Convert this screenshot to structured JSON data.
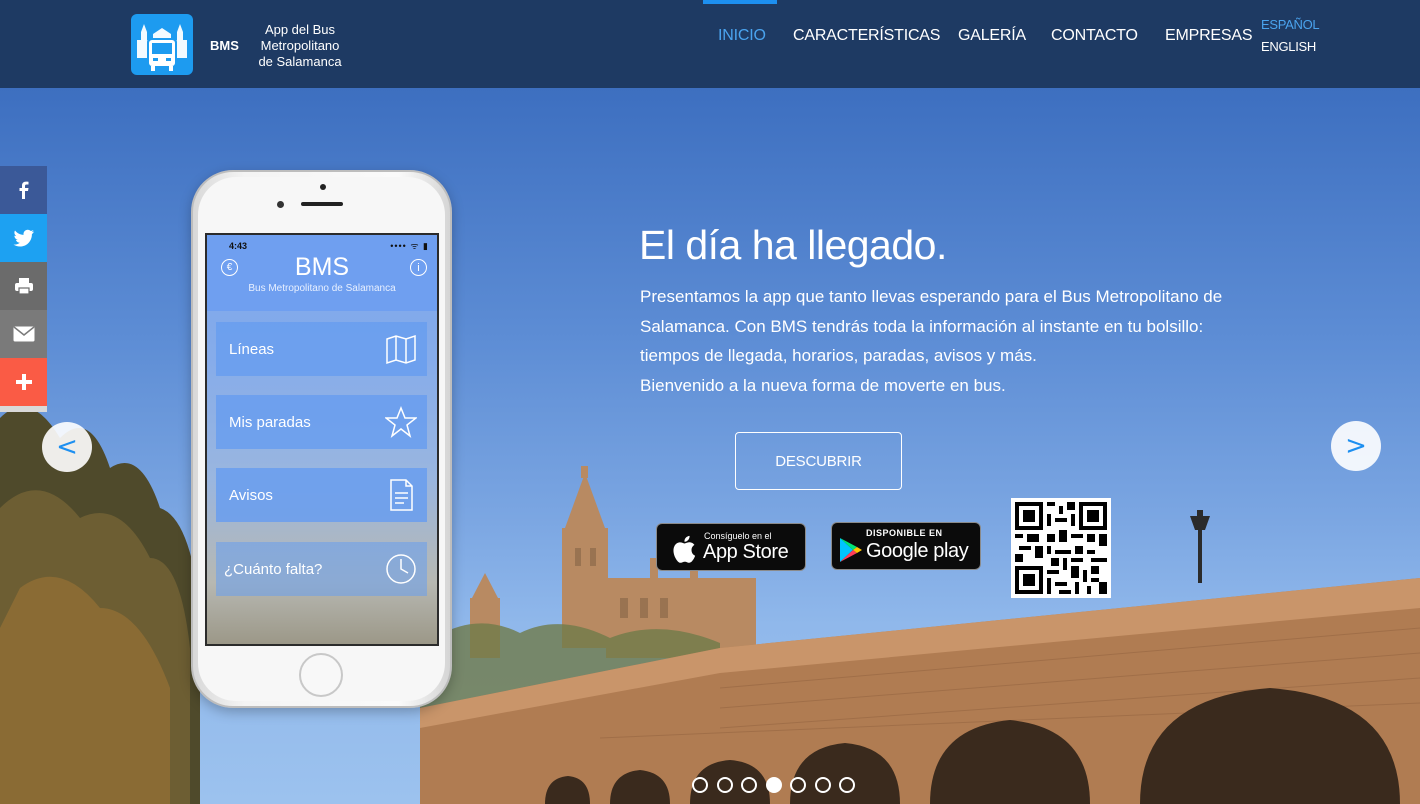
{
  "brand": {
    "short": "BMS",
    "tagline": [
      "App del Bus",
      "Metropolitano",
      "de Salamanca"
    ],
    "logo_icon": "bus-icon",
    "accent": "#1d8ff0"
  },
  "nav": {
    "items": [
      {
        "label": "INICIO",
        "active": true
      },
      {
        "label": "CARACTERÍSTICAS",
        "active": false
      },
      {
        "label": "GALERÍA",
        "active": false
      },
      {
        "label": "CONTACTO",
        "active": false
      },
      {
        "label": "EMPRESAS",
        "active": false
      }
    ],
    "languages": [
      {
        "label": "ESPAÑOL",
        "active": true
      },
      {
        "label": "ENGLISH",
        "active": false
      }
    ]
  },
  "social": [
    {
      "name": "facebook",
      "icon": "facebook-icon",
      "color": "#3b5998"
    },
    {
      "name": "twitter",
      "icon": "twitter-icon",
      "color": "#1da1f2"
    },
    {
      "name": "print",
      "icon": "printer-icon",
      "color": "#6b6b6b"
    },
    {
      "name": "email",
      "icon": "envelope-icon",
      "color": "#7a7a7a"
    },
    {
      "name": "more",
      "icon": "plus-icon",
      "color": "#fa5b45"
    }
  ],
  "carousel": {
    "prev": "<",
    "next": ">",
    "slide_count": 7,
    "active_slide": 4
  },
  "phone": {
    "time": "4:43",
    "status": "•••• ᯤ ▮",
    "app_title": "BMS",
    "app_subtitle": "Bus Metropolitano de Salamanca",
    "euro_symbol": "€",
    "info_symbol": "i",
    "menu": [
      {
        "label": "Líneas",
        "icon": "map-icon"
      },
      {
        "label": "Mis paradas",
        "icon": "star-icon"
      },
      {
        "label": "Avisos",
        "icon": "document-icon"
      },
      {
        "label": "¿Cuánto falta?",
        "icon": "clock-icon"
      }
    ]
  },
  "hero": {
    "headline": "El día ha llegado.",
    "paragraph_lines": [
      "Presentamos la app que tanto llevas esperando para el Bus Metropolitano de",
      "Salamanca. Con BMS tendrás toda la información al instante en tu bolsillo:",
      "tiempos de llegada, horarios, paradas, avisos y más.",
      "Bienvenido a la nueva forma de moverte en bus."
    ],
    "cta_label": "DESCUBRIR"
  },
  "stores": {
    "apple_small": "Consíguelo en el",
    "apple_big": "App Store",
    "google_small": "DISPONIBLE EN",
    "google_big": "Google play"
  }
}
